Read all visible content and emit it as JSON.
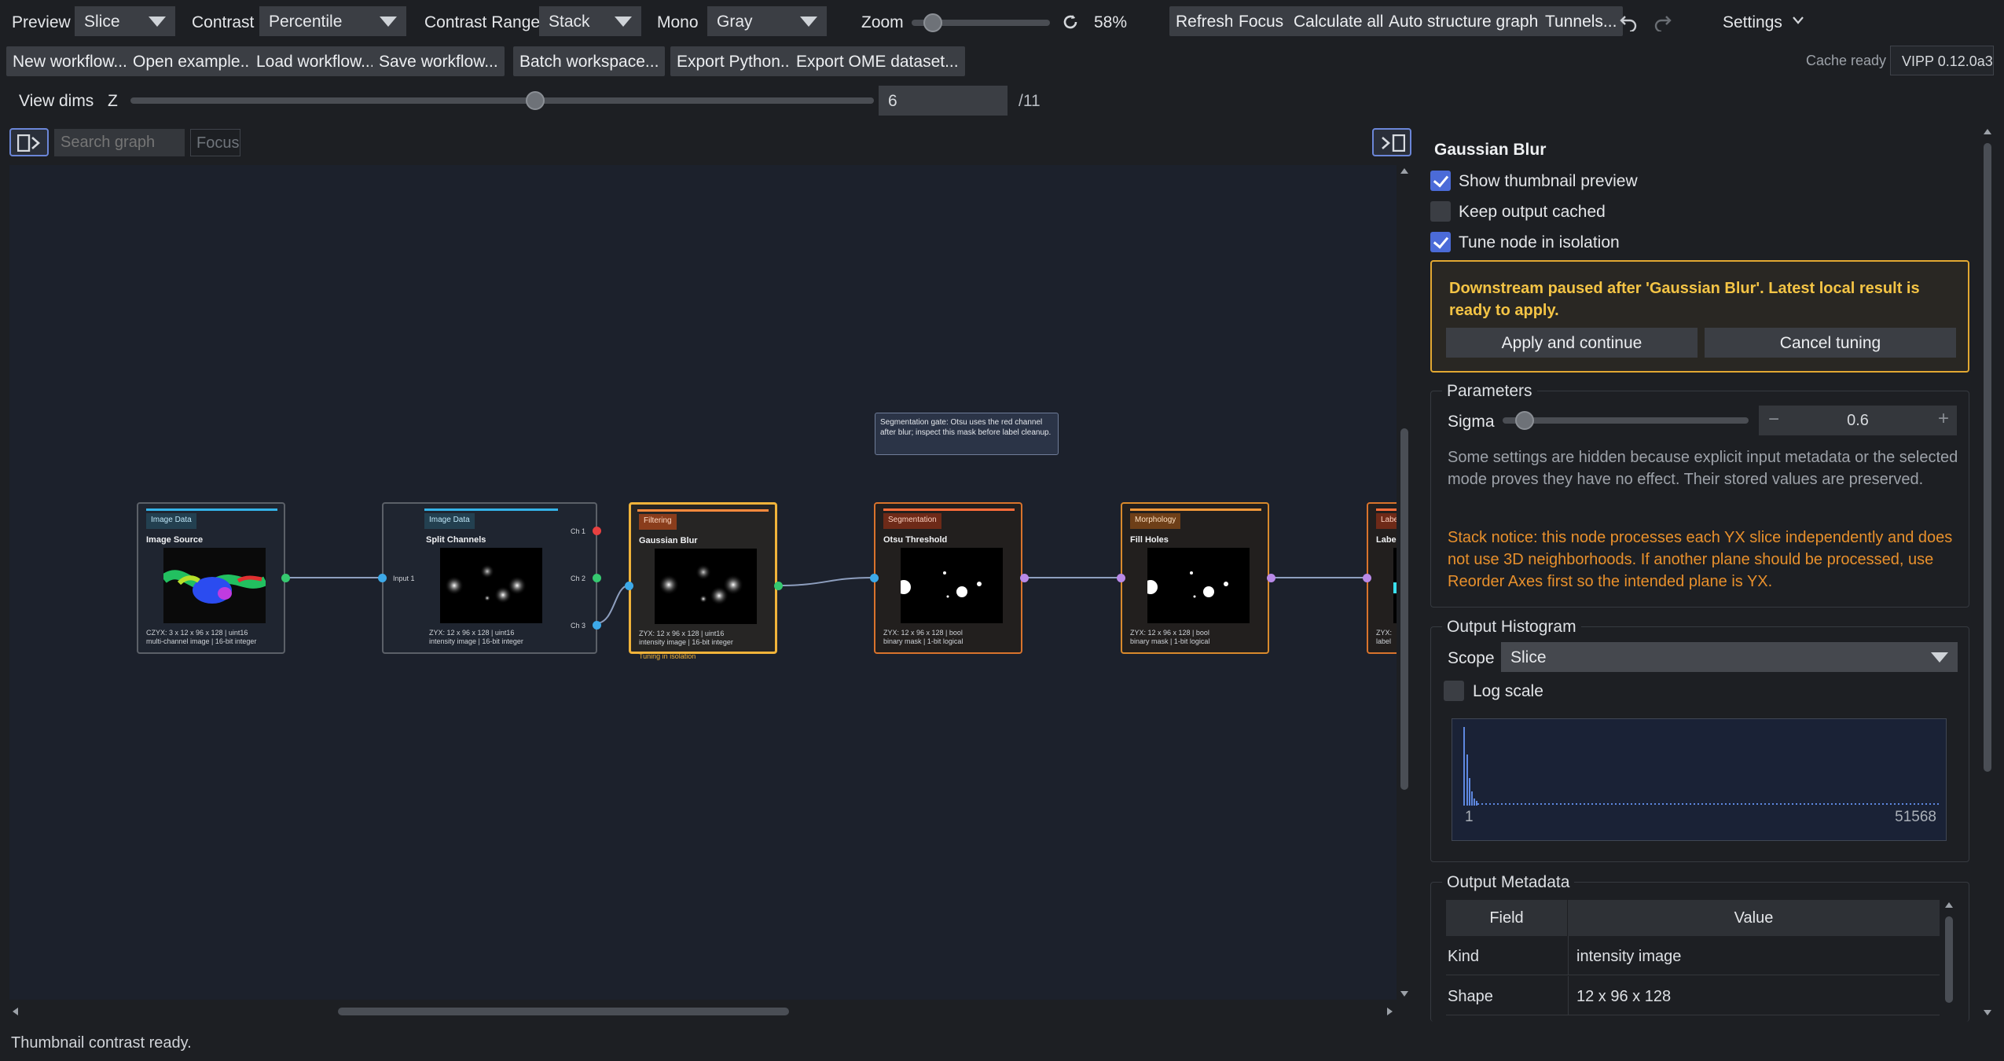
{
  "toolbar": {
    "preview_label": "Preview",
    "preview_value": "Slice",
    "contrast_label": "Contrast",
    "contrast_value": "Percentile",
    "contrast_range_label": "Contrast Range",
    "contrast_range_value": "Stack",
    "mono_label": "Mono",
    "mono_value": "Gray",
    "zoom_label": "Zoom",
    "zoom_value": "58%",
    "refresh_label": "Refresh",
    "focus_label": "Focus",
    "calculate_all_label": "Calculate all",
    "auto_structure_label": "Auto structure graph",
    "tunnels_label": "Tunnels...",
    "settings_label": "Settings"
  },
  "toolbar2": {
    "new_workflow": "New workflow...",
    "open_example": "Open example...",
    "load_workflow": "Load workflow...",
    "save_workflow": "Save workflow...",
    "batch_workspace": "Batch workspace...",
    "export_python": "Export Python...",
    "export_ome": "Export OME dataset...",
    "cache_status": "Cache ready",
    "version": "VIPP 0.12.0a3"
  },
  "view_dims": {
    "label": "View dims",
    "axis": "Z",
    "value": "6",
    "total": "/11",
    "fraction": 0.55
  },
  "graph": {
    "search_placeholder": "Search graph",
    "focus_label": "Focus",
    "annotation": "Segmentation gate: Otsu uses the red channel after blur; inspect this mask before label cleanup.",
    "nodes": [
      {
        "category": "Image Data",
        "title": "Image Source",
        "meta1": "CZYX: 3 x 12 x 96 x 128 | uint16",
        "meta2": "multi-channel image | 16-bit integer"
      },
      {
        "category": "Image Data",
        "title": "Split Channels",
        "meta1": "ZYX: 12 x 96 x 128 | uint16",
        "meta2": "intensity image | 16-bit integer",
        "input": "Input 1",
        "ch1": "Ch 1",
        "ch2": "Ch 2",
        "ch3": "Ch 3"
      },
      {
        "category": "Filtering",
        "title": "Gaussian Blur",
        "meta1": "ZYX: 12 x 96 x 128 | uint16",
        "meta2": "intensity image | 16-bit integer",
        "status": "Tuning in isolation"
      },
      {
        "category": "Segmentation",
        "title": "Otsu Threshold",
        "meta1": "ZYX: 12 x 96 x 128 | bool",
        "meta2": "binary mask | 1-bit logical"
      },
      {
        "category": "Morphology",
        "title": "Fill Holes",
        "meta1": "ZYX: 12 x 96 x 128 | bool",
        "meta2": "binary mask | 1-bit logical"
      },
      {
        "category": "Label",
        "title": "Label",
        "meta1": "ZYX:",
        "meta2": "label"
      }
    ]
  },
  "inspector": {
    "title": "Gaussian Blur",
    "show_thumbnail": "Show thumbnail preview",
    "keep_cached": "Keep output cached",
    "tune_isolation": "Tune node in isolation",
    "warning": "Downstream paused after 'Gaussian Blur'. Latest local result is ready to apply.",
    "apply_label": "Apply and continue",
    "cancel_label": "Cancel tuning",
    "parameters_title": "Parameters",
    "sigma_label": "Sigma",
    "sigma_value": "0.6",
    "hidden_note": "Some settings are hidden because explicit input metadata or the selected mode proves they have no effect. Their stored values are preserved.",
    "stack_notice": "Stack notice: this node processes each YX slice independently and does not use 3D neighborhoods. If another plane should be processed, use Reorder Axes first so the intended plane is YX.",
    "histogram_title": "Output Histogram",
    "scope_label": "Scope",
    "scope_value": "Slice",
    "log_scale": "Log scale",
    "hist_min": "1",
    "hist_max": "51568",
    "metadata_title": "Output Metadata",
    "meta_field_header": "Field",
    "meta_value_header": "Value",
    "meta_rows": [
      {
        "field": "Kind",
        "value": "intensity image"
      },
      {
        "field": "Shape",
        "value": "12 x 96 x 128"
      }
    ]
  },
  "status_bar": "Thumbnail contrast ready.",
  "colors": {
    "accent_blue": "#4b6bd8",
    "tuning_orange": "#f0b33a",
    "warning_text": "#f4c445",
    "notice_orange": "#e8902c"
  }
}
